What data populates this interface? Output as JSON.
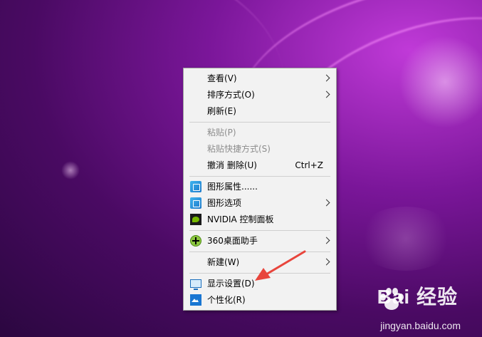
{
  "context_menu": {
    "items": [
      {
        "label": "查看(V)",
        "submenu": true
      },
      {
        "label": "排序方式(O)",
        "submenu": true
      },
      {
        "label": "刷新(E)"
      },
      {
        "label": "粘贴(P)",
        "disabled": true
      },
      {
        "label": "粘贴快捷方式(S)",
        "disabled": true
      },
      {
        "label": "撤消 删除(U)",
        "shortcut": "Ctrl+Z"
      },
      {
        "label": "图形属性......",
        "icon": "intel-graphics-icon"
      },
      {
        "label": "图形选项",
        "icon": "intel-graphics-icon",
        "submenu": true
      },
      {
        "label": "NVIDIA 控制面板",
        "icon": "nvidia-icon"
      },
      {
        "label": "360桌面助手",
        "icon": "360-plus-icon",
        "submenu": true
      },
      {
        "label": "新建(W)",
        "submenu": true
      },
      {
        "label": "显示设置(D)",
        "icon": "display-icon"
      },
      {
        "label": "个性化(R)",
        "icon": "personalize-icon"
      }
    ]
  },
  "annotation": {
    "color": "#e8453c"
  },
  "watermark": {
    "brand": "Bai 经验",
    "url": "jingyan.baidu.com"
  }
}
